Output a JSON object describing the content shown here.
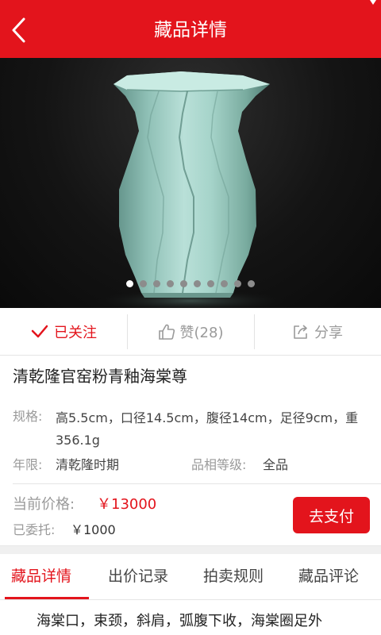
{
  "header": {
    "title": "藏品详情",
    "back_icon": "chevron-left-icon",
    "color": "#e3141c"
  },
  "gallery": {
    "image_subject": "celadon-vase",
    "slide_count": 10,
    "active_slide": 1
  },
  "actions": {
    "follow_label": "已关注",
    "like_label": "赞(28)",
    "share_label": "分享"
  },
  "item": {
    "name": "清乾隆官窑粉青釉海棠尊",
    "spec_label": "规格:",
    "spec_value": "高5.5cm，口径14.5cm，腹径14cm，足径9cm，重356.1g",
    "era_label": "年限:",
    "era_value": "清乾隆时期",
    "grade_label": "品相等级:",
    "grade_value": "全品"
  },
  "price": {
    "current_label": "当前价格:",
    "current_value": "￥13000",
    "deposit_label": "已委托:",
    "deposit_value": "￥1000",
    "pay_button": "去支付"
  },
  "tabs": [
    {
      "label": "藏品详情",
      "active": true
    },
    {
      "label": "出价记录",
      "active": false
    },
    {
      "label": "拍卖规则",
      "active": false
    },
    {
      "label": "藏品评论",
      "active": false
    }
  ],
  "description": "海棠口，束颈，斜肩，弧腹下收，海棠圈足外"
}
